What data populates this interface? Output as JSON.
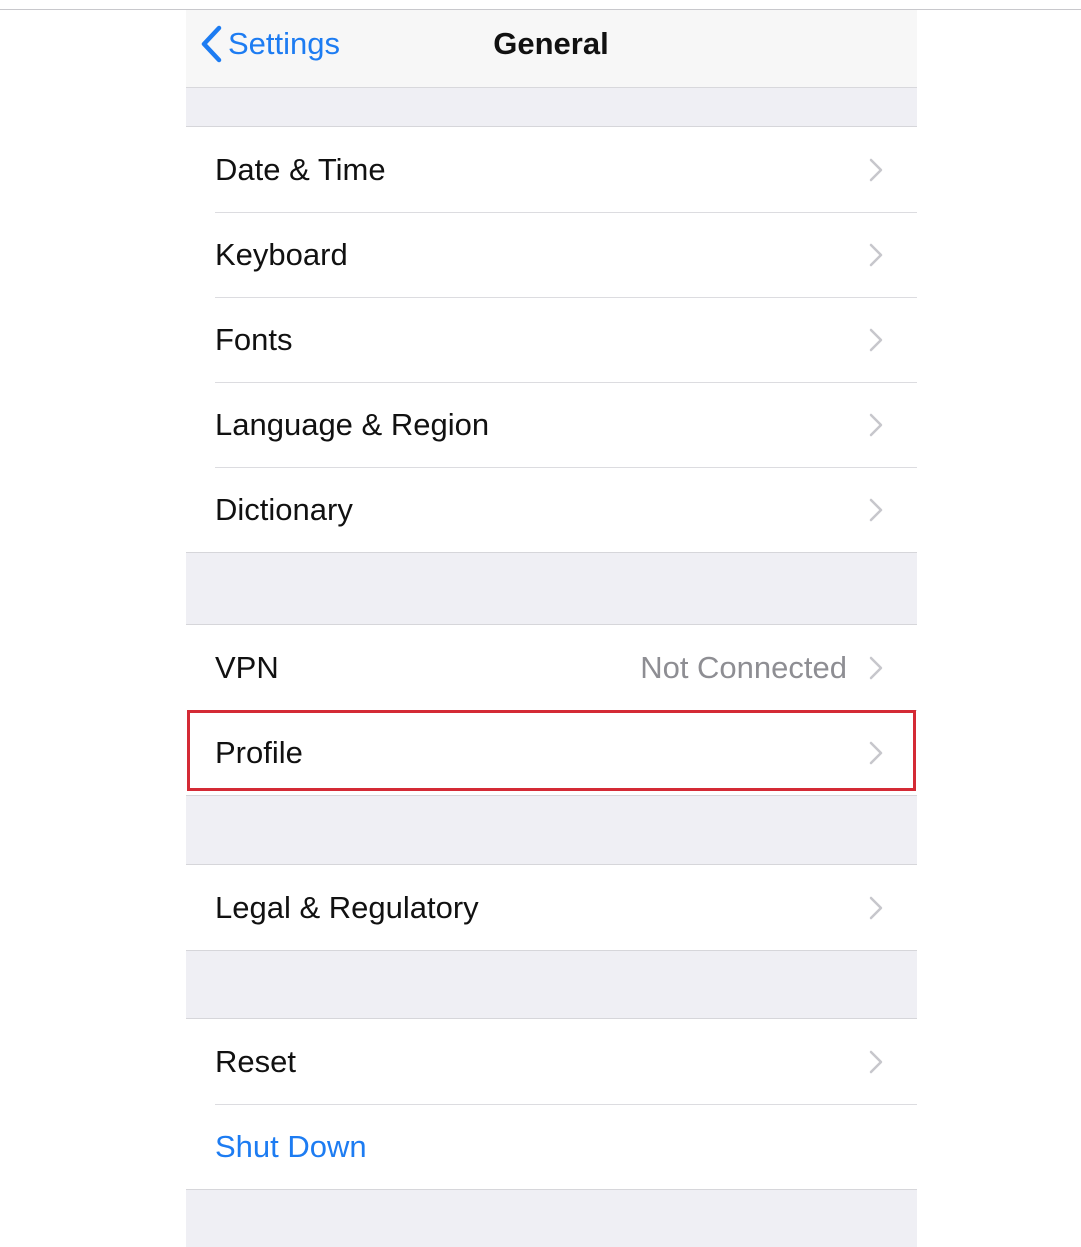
{
  "navbar": {
    "back_label": "Settings",
    "title": "General"
  },
  "groups": [
    {
      "items": [
        {
          "label": "Date & Time"
        },
        {
          "label": "Keyboard"
        },
        {
          "label": "Fonts"
        },
        {
          "label": "Language & Region"
        },
        {
          "label": "Dictionary"
        }
      ]
    },
    {
      "items": [
        {
          "label": "VPN",
          "value": "Not Connected"
        },
        {
          "label": "Profile"
        }
      ]
    },
    {
      "items": [
        {
          "label": "Legal & Regulatory"
        }
      ]
    },
    {
      "items": [
        {
          "label": "Reset"
        },
        {
          "label": "Shut Down"
        }
      ]
    }
  ],
  "colors": {
    "accent": "#1d7cf2",
    "highlight_box": "#d42a35",
    "background": "#efeff4"
  },
  "icons": [
    "chevron-left-icon",
    "chevron-right-icon"
  ]
}
